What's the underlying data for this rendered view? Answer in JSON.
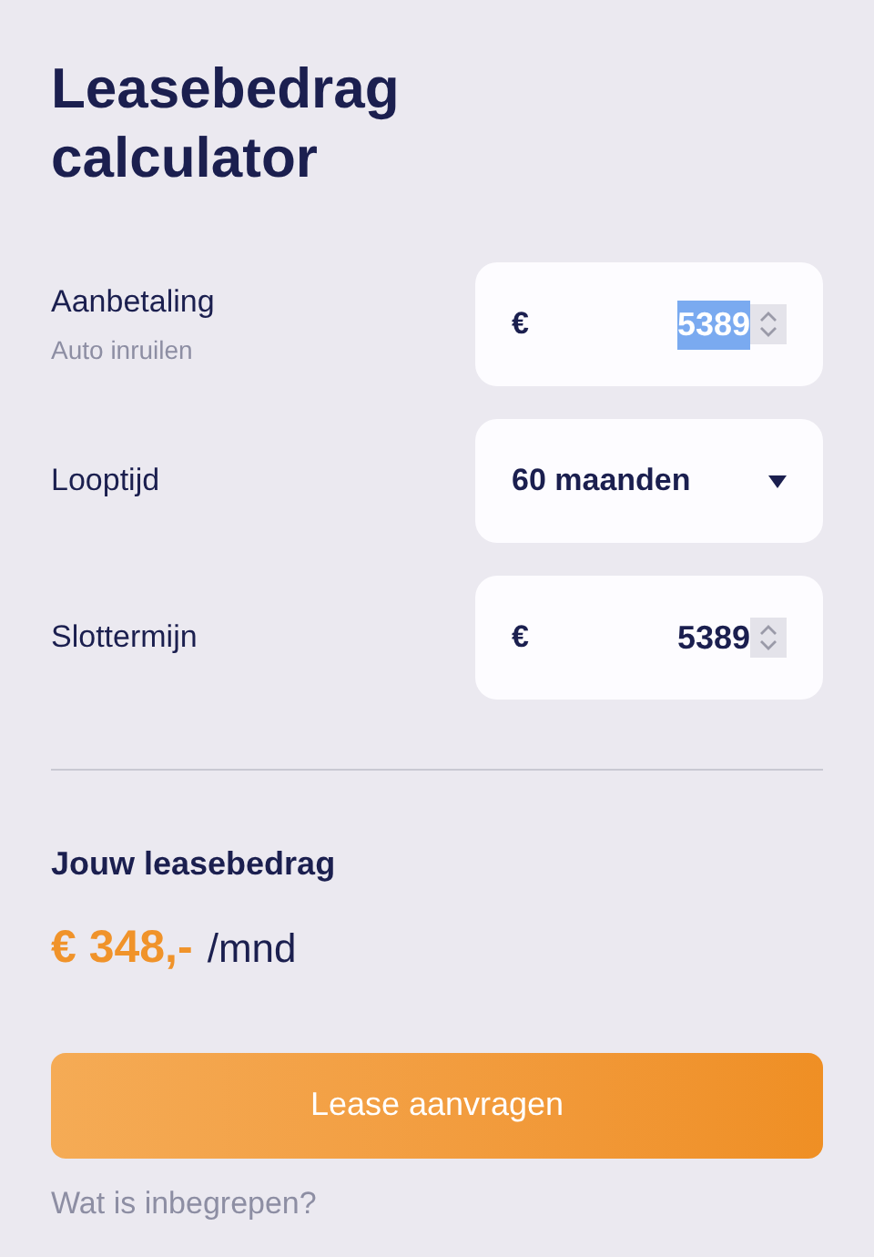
{
  "title": "Leasebedrag calculator",
  "fields": [
    {
      "kind": "number",
      "label": "Aanbetaling",
      "sublabel": "Auto inruilen",
      "currency": "€",
      "value": "5389",
      "text_selected": true
    },
    {
      "kind": "select",
      "label": "Looptijd",
      "value": "60 maanden"
    },
    {
      "kind": "number",
      "label": "Slottermijn",
      "currency": "€",
      "value": "5389",
      "text_selected": false
    }
  ],
  "result": {
    "heading": "Jouw leasebedrag",
    "amount": "€ 348,-",
    "unit": "/mnd"
  },
  "primary_button": "Lease aanvragen",
  "link": "Wat is inbegrepen?"
}
